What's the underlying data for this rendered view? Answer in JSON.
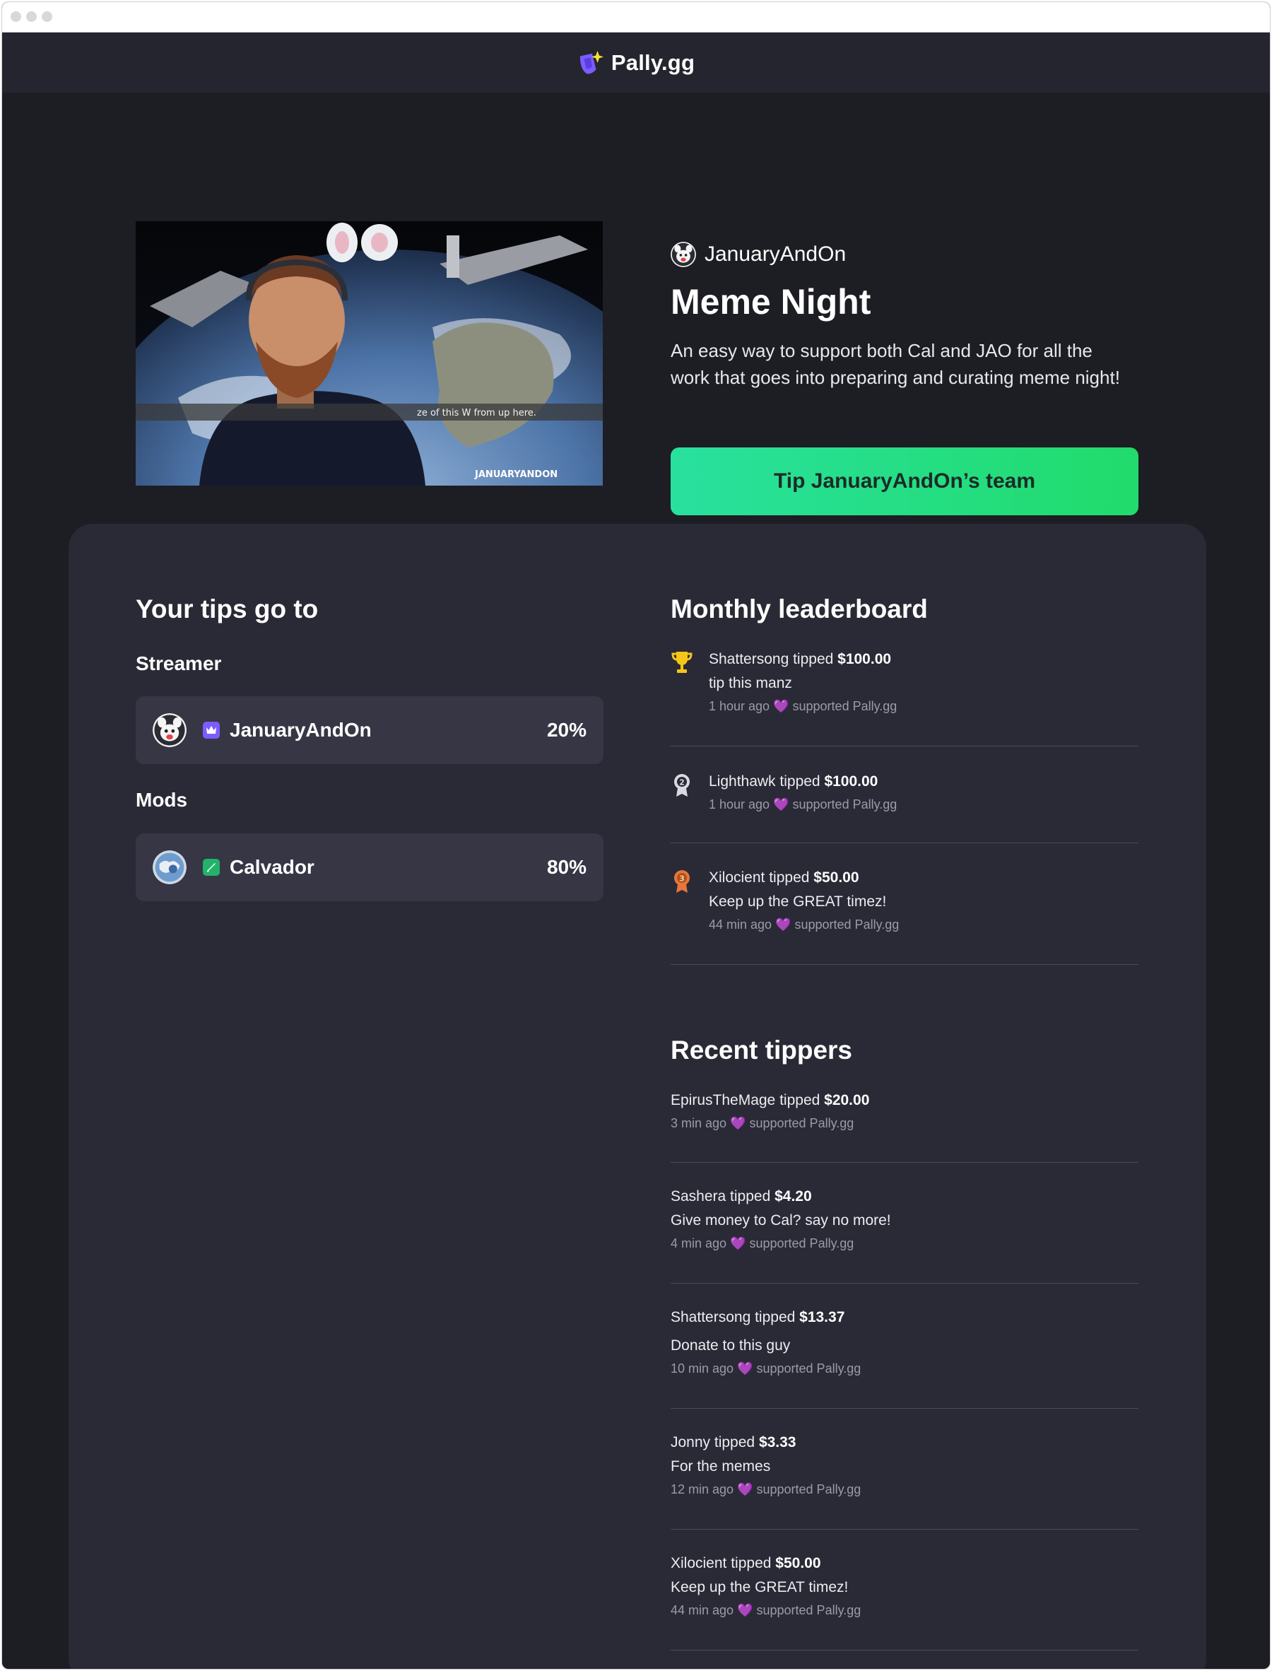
{
  "brand": {
    "name": "Pally.gg"
  },
  "hero": {
    "video_caption": "ze of this W from up here.",
    "video_watermark": "JANUARYANDON",
    "creator_name": "JanuaryAndOn",
    "title": "Meme Night",
    "description": "An easy way to support both Cal and JAO for all the work that goes into preparing and curating meme night!",
    "tip_button_label": "Tip JanuaryAndOn’s team"
  },
  "tips_split": {
    "heading": "Your tips go to",
    "streamer_label": "Streamer",
    "streamer": {
      "name": "JanuaryAndOn",
      "percent": "20%",
      "badge_icon": "crown-icon"
    },
    "mods_label": "Mods",
    "mods": [
      {
        "name": "Calvador",
        "percent": "80%",
        "badge_icon": "sword-icon"
      }
    ]
  },
  "leaderboard": {
    "heading": "Monthly leaderboard",
    "entries": [
      {
        "rank_icon": "trophy-icon",
        "name": "Shattersong",
        "verb": " tipped ",
        "amount": "$100.00",
        "message": "tip this manz",
        "time": "1 hour ago",
        "heart": "💜",
        "note": " supported Pally.gg"
      },
      {
        "rank_icon": "medal-2-icon",
        "name": "Lighthawk",
        "verb": " tipped ",
        "amount": "$100.00",
        "message": "",
        "time": "1 hour ago",
        "heart": "💜",
        "note": " supported Pally.gg"
      },
      {
        "rank_icon": "medal-3-icon",
        "name": "Xilocient",
        "verb": " tipped ",
        "amount": "$50.00",
        "message": "Keep up the GREAT timez!",
        "time": "44 min ago",
        "heart": "💜",
        "note": " supported Pally.gg"
      }
    ]
  },
  "recent": {
    "heading": "Recent tippers",
    "entries": [
      {
        "name": "EpirusTheMage",
        "verb": " tipped ",
        "amount": "$20.00",
        "message": "",
        "time": "3 min ago",
        "heart": "💜",
        "note": " supported Pally.gg"
      },
      {
        "name": "Sashera",
        "verb": " tipped ",
        "amount": "$4.20",
        "message": "Give money to Cal? say no more!",
        "time": "4 min ago",
        "heart": "💜",
        "note": " supported Pally.gg"
      },
      {
        "name": "Shattersong",
        "verb": " tipped ",
        "amount": "$13.37",
        "message": "Donate to this guy",
        "time": "10 min ago",
        "heart": "💜",
        "note": " supported Pally.gg"
      },
      {
        "name": "Jonny",
        "verb": " tipped ",
        "amount": "$3.33",
        "message": "For the memes",
        "time": "12 min ago",
        "heart": "💜",
        "note": " supported Pally.gg"
      },
      {
        "name": "Xilocient",
        "verb": " tipped ",
        "amount": "$50.00",
        "message": "Keep up the GREAT timez!",
        "time": "44 min ago",
        "heart": "💜",
        "note": " supported Pally.gg"
      }
    ]
  },
  "colors": {
    "page_bg": "#1d1d24",
    "panel_bg": "#2a2a36",
    "card_bg": "#363645",
    "accent_green_start": "#29e19e",
    "accent_green_end": "#21db6c",
    "crown_badge": "#7c5cff",
    "sword_badge": "#22b36a",
    "gold": "#f5c518",
    "silver": "#d9d9e0",
    "bronze": "#e5773a",
    "heart": "#b04dff"
  }
}
